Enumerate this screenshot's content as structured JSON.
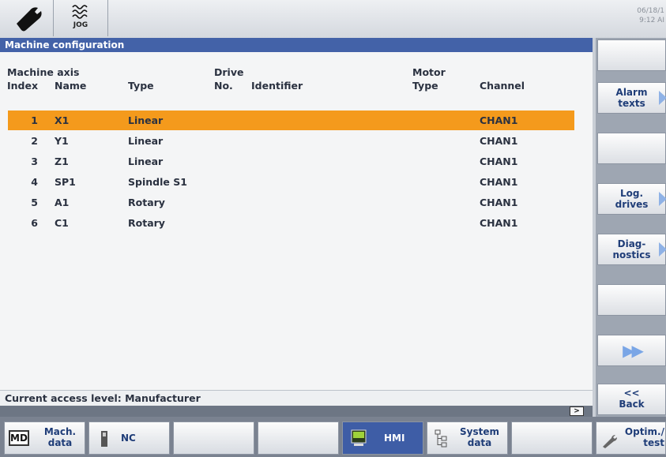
{
  "topbar": {
    "mode_label": "JOG",
    "datetime_line1": "06/18/1",
    "datetime_line2": "9:12 AI"
  },
  "window": {
    "title": "Machine configuration"
  },
  "table": {
    "group_header_axis": "Machine axis",
    "group_header_drive": "Drive",
    "group_header_motor": "Motor",
    "col_index": "Index",
    "col_name": "Name",
    "col_type": "Type",
    "col_drive_no": "No.",
    "col_identifier": "Identifier",
    "col_motor_type": "Type",
    "col_channel": "Channel",
    "rows": [
      {
        "index": "1",
        "name": "X1",
        "type": "Linear",
        "channel": "CHAN1"
      },
      {
        "index": "2",
        "name": "Y1",
        "type": "Linear",
        "channel": "CHAN1"
      },
      {
        "index": "3",
        "name": "Z1",
        "type": "Linear",
        "channel": "CHAN1"
      },
      {
        "index": "4",
        "name": "SP1",
        "type": "Spindle S1",
        "channel": "CHAN1"
      },
      {
        "index": "5",
        "name": "A1",
        "type": "Rotary",
        "channel": "CHAN1"
      },
      {
        "index": "6",
        "name": "C1",
        "type": "Rotary",
        "channel": "CHAN1"
      }
    ],
    "selected_row": 0
  },
  "status": {
    "access_level": "Current access level: Manufacturer",
    "scroll_right_glyph": ">"
  },
  "vertical_softkeys": {
    "alarm_line1": "Alarm",
    "alarm_line2": "texts",
    "log_line1": "Log.",
    "log_line2": "drives",
    "diag_line1": "Diag-",
    "diag_line2": "nostics",
    "forward_glyph": "▶▶",
    "back_glyph": "<<",
    "back_label": "Back"
  },
  "horizontal_softkeys": {
    "md_icon_text": "MD",
    "mach_line1": "Mach.",
    "mach_line2": "data",
    "nc_label": "NC",
    "hmi_label": "HMI",
    "system_line1": "System",
    "system_line2": "data",
    "optim_line1": "Optim./",
    "optim_line2": "test"
  },
  "colors": {
    "title_bar": "#4362a8",
    "selected_row": "#f49a1c",
    "active_softkey": "#3e5da6",
    "softkey_text": "#1f3d78"
  },
  "icons": [
    "wrench-icon",
    "jog-wave-icon",
    "softkey-arrow-icon",
    "drive-icon",
    "hmi-screen-icon",
    "system-tree-icon",
    "optim-tool-icon"
  ]
}
